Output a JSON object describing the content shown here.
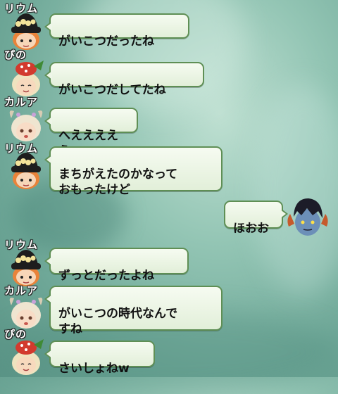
{
  "chat": {
    "messages": [
      {
        "speaker": "リウム",
        "text": "がいこつだったね",
        "avatar": "rium-avatar"
      },
      {
        "speaker": "ぴの",
        "text": "がいこつだしてたね",
        "avatar": "pino-avatar"
      },
      {
        "speaker": "カルア",
        "text": "へえええええ",
        "avatar": "karua-avatar"
      },
      {
        "speaker": "リウム",
        "text": "まちがえたのかなって\nおもったけど",
        "avatar": "rium-avatar"
      },
      {
        "speaker": "",
        "text": "ほおお",
        "avatar": "self-avatar"
      },
      {
        "speaker": "リウム",
        "text": "ずっとだったよね",
        "avatar": "rium-avatar"
      },
      {
        "speaker": "カルア",
        "text": "がいこつの時代なんで\nすね",
        "avatar": "karua-avatar"
      },
      {
        "speaker": "ぴの",
        "text": "さいしょねw",
        "avatar": "pino-avatar"
      }
    ]
  },
  "colors": {
    "bubble_border": "#5f8f55",
    "bubble_fill": "#eef6e8",
    "background": "#93c5b4"
  }
}
